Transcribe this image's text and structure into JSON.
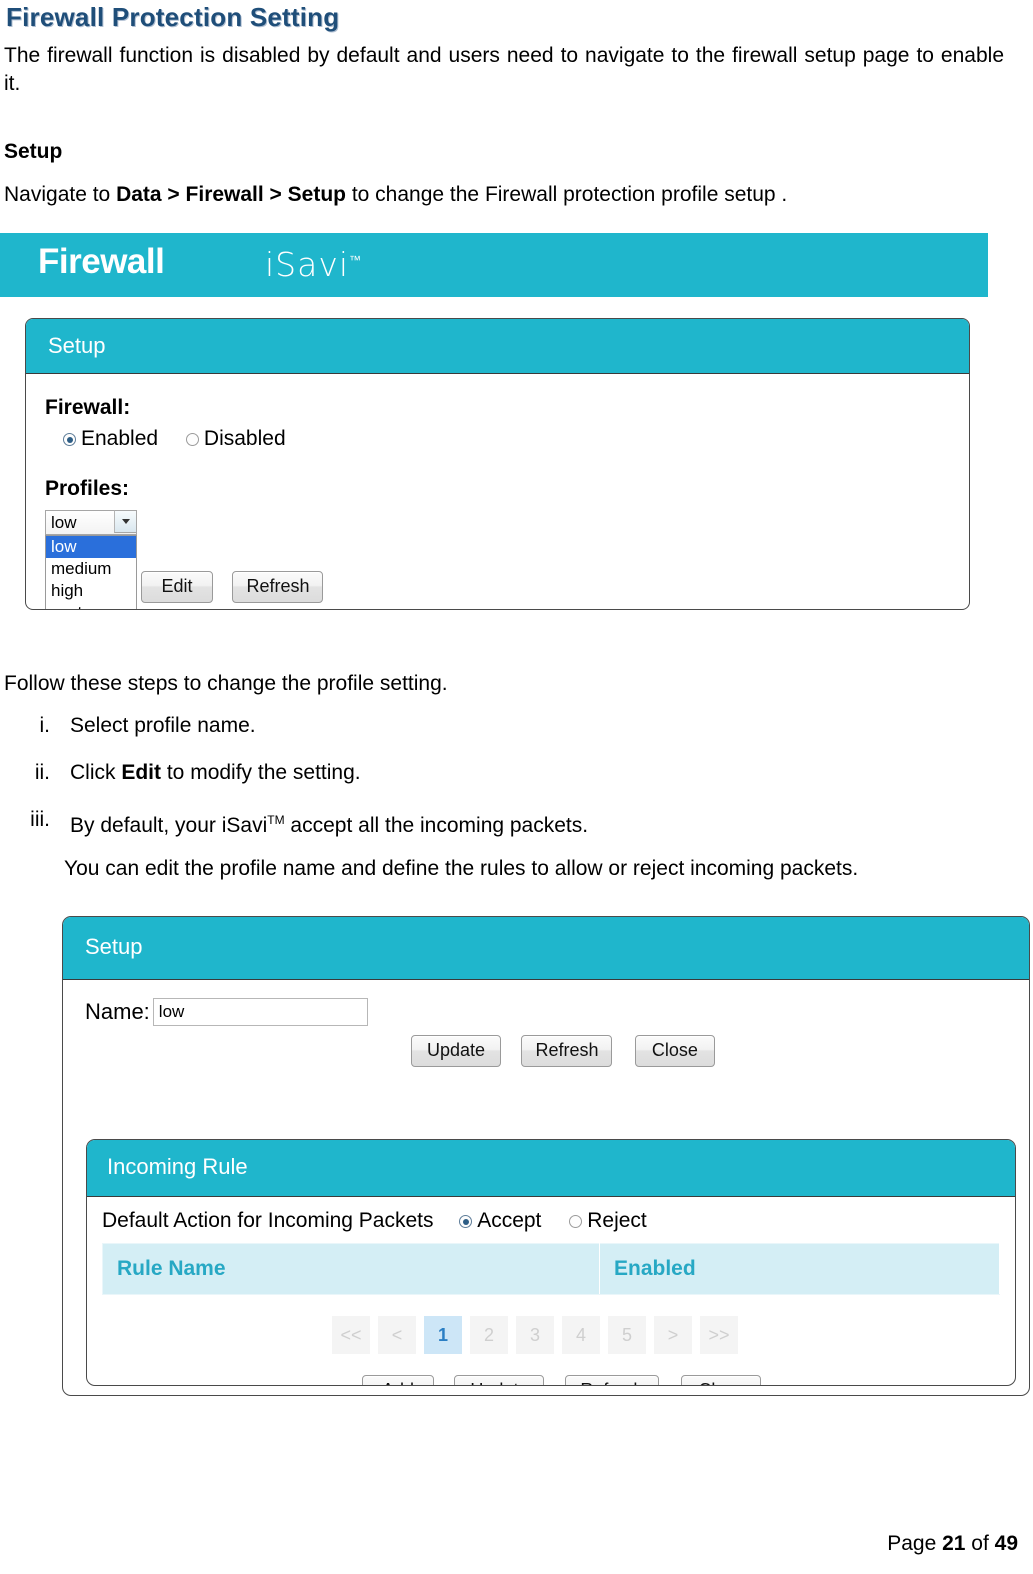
{
  "document": {
    "title": "Firewall Protection Setting",
    "intro": "The firewall function is disabled by default and users need to navigate to the firewall setup page to enable it.",
    "section_heading": "Setup",
    "navigate_prefix": "Navigate to ",
    "navigate_path": "Data > Firewall > Setup",
    "navigate_suffix": " to change the Firewall protection profile setup .",
    "follow_line": "Follow these steps to change the profile setting.",
    "steps": [
      {
        "marker": "i.",
        "text": "Select profile name."
      },
      {
        "marker": "ii.",
        "prefix": "Click ",
        "bold": "Edit",
        "suffix": " to modify the setting."
      },
      {
        "marker": "iii.",
        "prefix": "By default, your iSavi",
        "sup": "TM",
        "suffix": " accept all the incoming packets."
      }
    ],
    "substep": "You can edit the profile name and define the rules to allow or reject incoming packets.",
    "footer_prefix": "Page ",
    "footer_page": "21",
    "footer_mid": " of ",
    "footer_total": "49"
  },
  "screenshot1": {
    "banner": {
      "title": "Firewall",
      "logo": "iSavi",
      "tm": "™"
    },
    "panel": {
      "header": "Setup"
    },
    "firewall": {
      "label": "Firewall:",
      "options": [
        {
          "label": "Enabled",
          "checked": true
        },
        {
          "label": "Disabled",
          "checked": false
        }
      ]
    },
    "profiles": {
      "label": "Profiles:",
      "selected": "low",
      "options": [
        "low",
        "medium",
        "high",
        "custom"
      ],
      "expanded": true
    },
    "buttons": [
      {
        "label": "Edit"
      },
      {
        "label": "Refresh"
      }
    ]
  },
  "screenshot2": {
    "setup_panel": {
      "header": "Setup"
    },
    "name_field": {
      "label": "Name:",
      "value": "low"
    },
    "setup_buttons": [
      {
        "label": "Update"
      },
      {
        "label": "Refresh"
      },
      {
        "label": "Close"
      }
    ],
    "incoming_panel": {
      "header": "Incoming Rule"
    },
    "default_action": {
      "label": "Default Action for Incoming Packets",
      "options": [
        {
          "label": "Accept",
          "checked": true
        },
        {
          "label": "Reject",
          "checked": false
        }
      ]
    },
    "table": {
      "columns": [
        "Rule Name",
        "Enabled"
      ],
      "rows": []
    },
    "pagination": {
      "items": [
        "<<",
        "<",
        "1",
        "2",
        "3",
        "4",
        "5",
        ">",
        ">>"
      ],
      "active": "1"
    },
    "rule_buttons": [
      {
        "label": "Add"
      },
      {
        "label": "Update"
      },
      {
        "label": "Refresh"
      },
      {
        "label": "Close"
      }
    ]
  },
  "colors": {
    "teal": "#1fb6cc",
    "title_navy": "#1f4e79",
    "table_header_bg": "#d4eef5",
    "table_header_text": "#27a8c4",
    "pager_active_bg": "#cde6f7"
  }
}
